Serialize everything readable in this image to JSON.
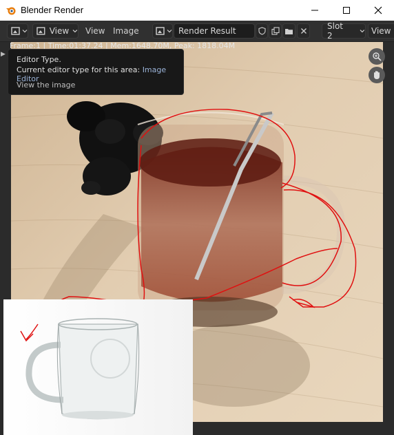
{
  "window": {
    "title": "Blender Render",
    "controls": [
      "minimize-icon",
      "maximize-icon",
      "close-icon"
    ]
  },
  "header": {
    "view_label": "View",
    "menus": [
      "View",
      "Image"
    ],
    "image_name": "Render Result",
    "slot": "Slot 2",
    "view_layer": "View L"
  },
  "stats": {
    "text": "Frame:1 | Time:01:37.24 | Mem:1648.70M, Peak: 1818.04M"
  },
  "tooltip": {
    "title": "Editor Type.",
    "description_prefix": "Current editor type for this area:",
    "description_value": "Image Editor",
    "python": "View the image"
  },
  "colors": {
    "header_bg": "#303030",
    "tooltip_bg": "#181818",
    "tooltip_value": "#9bb3d8",
    "annotation": "#e01010"
  }
}
